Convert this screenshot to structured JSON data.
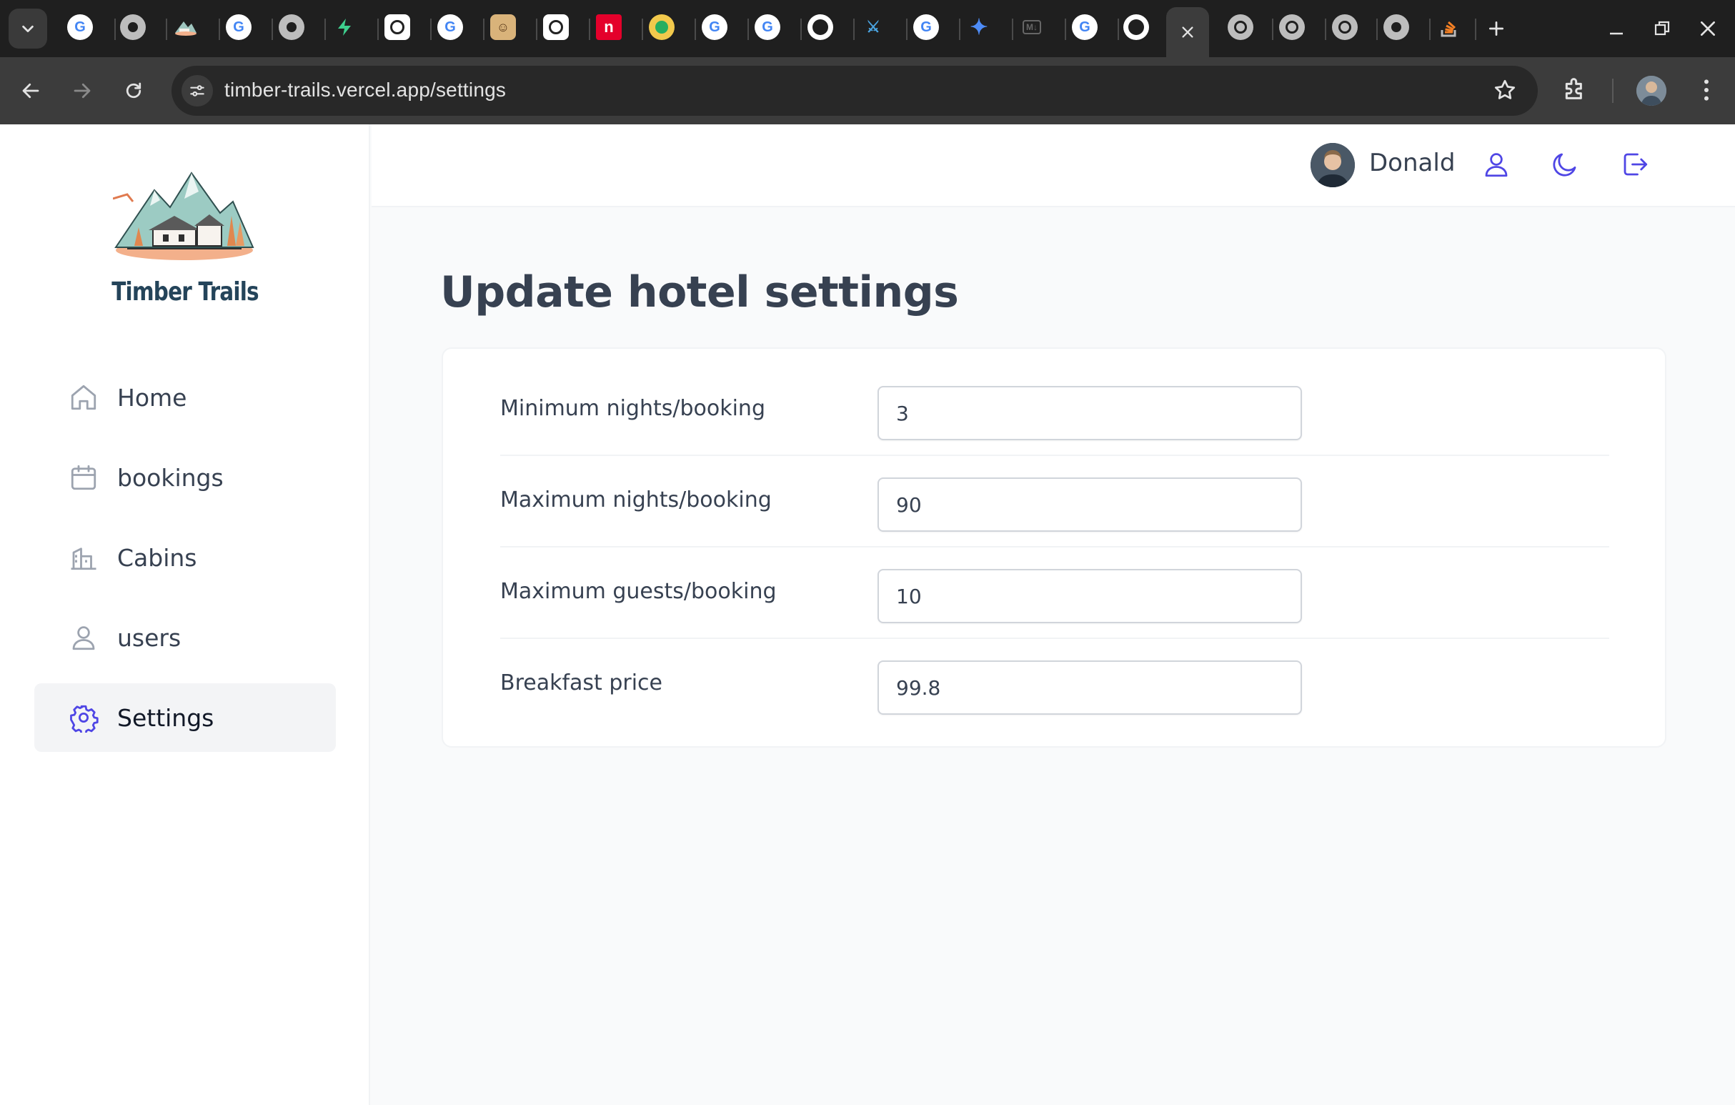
{
  "browser": {
    "url": "timber-trails.vercel.app/settings",
    "tabs": [
      {
        "icon": "google-icon"
      },
      {
        "icon": "chrome-icon"
      },
      {
        "icon": "timber-trails-icon"
      },
      {
        "icon": "google-icon"
      },
      {
        "icon": "chrome-icon"
      },
      {
        "icon": "supabase-icon"
      },
      {
        "icon": "chatgpt-icon"
      },
      {
        "icon": "google-icon"
      },
      {
        "icon": "avatar-tab-icon"
      },
      {
        "icon": "chatgpt-icon"
      },
      {
        "icon": "netlify-icon"
      },
      {
        "icon": "colorful-ball-icon"
      },
      {
        "icon": "google-icon"
      },
      {
        "icon": "google-icon"
      },
      {
        "icon": "github-icon"
      },
      {
        "icon": "star-wars-icon"
      },
      {
        "icon": "google-icon"
      },
      {
        "icon": "gemini-icon"
      },
      {
        "icon": "markdown-icon"
      },
      {
        "icon": "google-icon"
      },
      {
        "icon": "github-icon"
      },
      {
        "icon": "close-icon",
        "active": true
      },
      {
        "icon": "globe-icon"
      },
      {
        "icon": "globe-icon"
      },
      {
        "icon": "globe-icon"
      },
      {
        "icon": "chrome-icon"
      },
      {
        "icon": "stackoverflow-icon"
      }
    ]
  },
  "brand": {
    "name": "Timber Trails"
  },
  "sidebar": {
    "items": [
      {
        "label": "Home",
        "icon": "home-icon"
      },
      {
        "label": "bookings",
        "icon": "calendar-icon"
      },
      {
        "label": "Cabins",
        "icon": "building-icon"
      },
      {
        "label": "users",
        "icon": "user-icon"
      },
      {
        "label": "Settings",
        "icon": "gear-icon",
        "active": true
      }
    ]
  },
  "header": {
    "username": "Donald"
  },
  "main": {
    "title": "Update hotel settings",
    "settings": [
      {
        "label": "Minimum nights/booking",
        "value": "3"
      },
      {
        "label": "Maximum nights/booking",
        "value": "90"
      },
      {
        "label": "Maximum guests/booking",
        "value": "10"
      },
      {
        "label": "Breakfast price",
        "value": "99.8"
      }
    ]
  },
  "colors": {
    "accent": "#4f46e5",
    "text": "#374151",
    "brand": "#24445a",
    "chrome_dark": "#1f1f1f"
  }
}
